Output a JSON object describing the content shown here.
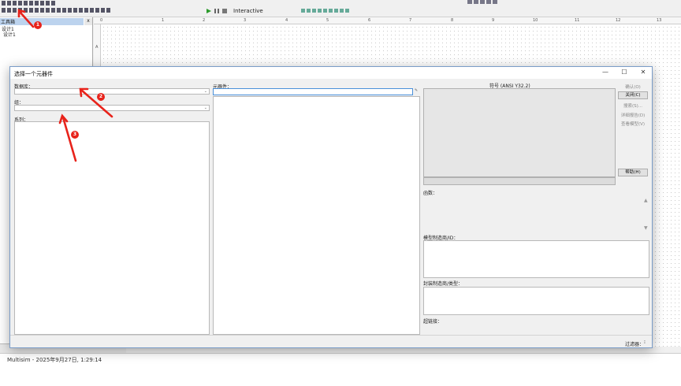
{
  "app": {
    "toolbar": {
      "sim_mode": "Interactive"
    },
    "panel": {
      "title": "工具箱",
      "close": "x",
      "tree": [
        "设计1",
        "设计1"
      ]
    },
    "ruler_numbers": [
      "0",
      "1",
      "2",
      "3",
      "4",
      "5",
      "6",
      "7",
      "8",
      "9",
      "10",
      "11",
      "12",
      "13"
    ],
    "ruler_left_letters": [
      "A"
    ],
    "status": {
      "text": "Multisim  -  2025年9月27日, 1:29:14"
    }
  },
  "dialog": {
    "title": "选择一个元器件",
    "window_buttons": {
      "min": "—",
      "max": "☐",
      "close": "✕"
    },
    "database_label": "数据库：",
    "group_label": "组：",
    "family_label": "系列：",
    "component_label": "元器件：",
    "symbol_label": "符号 (ANSI Y32.2)",
    "function_label": "函数：",
    "model_label": "模型制造商/ID：",
    "footprint_label": "封装制造商/类型：",
    "hyperlink_label": "超链接：",
    "filter_label": "过滤器：",
    "buttons": {
      "ok": "确认(O)",
      "close": "关闭(C)",
      "search": "搜索(S)...",
      "detail_report": "详细报告(D)",
      "view_model": "查看模型(V)",
      "help": "帮助(H)"
    }
  },
  "annotations": [
    {
      "number": "1"
    },
    {
      "number": "2"
    },
    {
      "number": "3"
    }
  ],
  "colors": {
    "accent": "#e8231b",
    "dialog_border": "#7a9cc8",
    "selected_field": "#4a90d9"
  }
}
